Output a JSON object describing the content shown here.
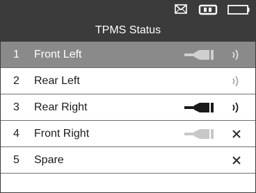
{
  "header": {
    "title": "TPMS Status",
    "icons": [
      "mail-icon",
      "vci-connection-icon",
      "battery-icon"
    ]
  },
  "sensors": [
    {
      "number": "1",
      "name": "Front Left",
      "selected": true,
      "plug": "light",
      "status": "signal"
    },
    {
      "number": "2",
      "name": "Rear Left",
      "selected": false,
      "plug": "none",
      "status": "signal-light"
    },
    {
      "number": "3",
      "name": "Rear Right",
      "selected": false,
      "plug": "dark",
      "status": "signal"
    },
    {
      "number": "4",
      "name": "Front Right",
      "selected": false,
      "plug": "light",
      "status": "fail"
    },
    {
      "number": "5",
      "name": "Spare",
      "selected": false,
      "plug": "none",
      "status": "fail"
    }
  ],
  "colors": {
    "header_bg": "#3b3b3b",
    "selected_row_bg": "#8a8a8a",
    "plug_dark": "#1a1a1a",
    "plug_light": "#cfcfcf"
  }
}
